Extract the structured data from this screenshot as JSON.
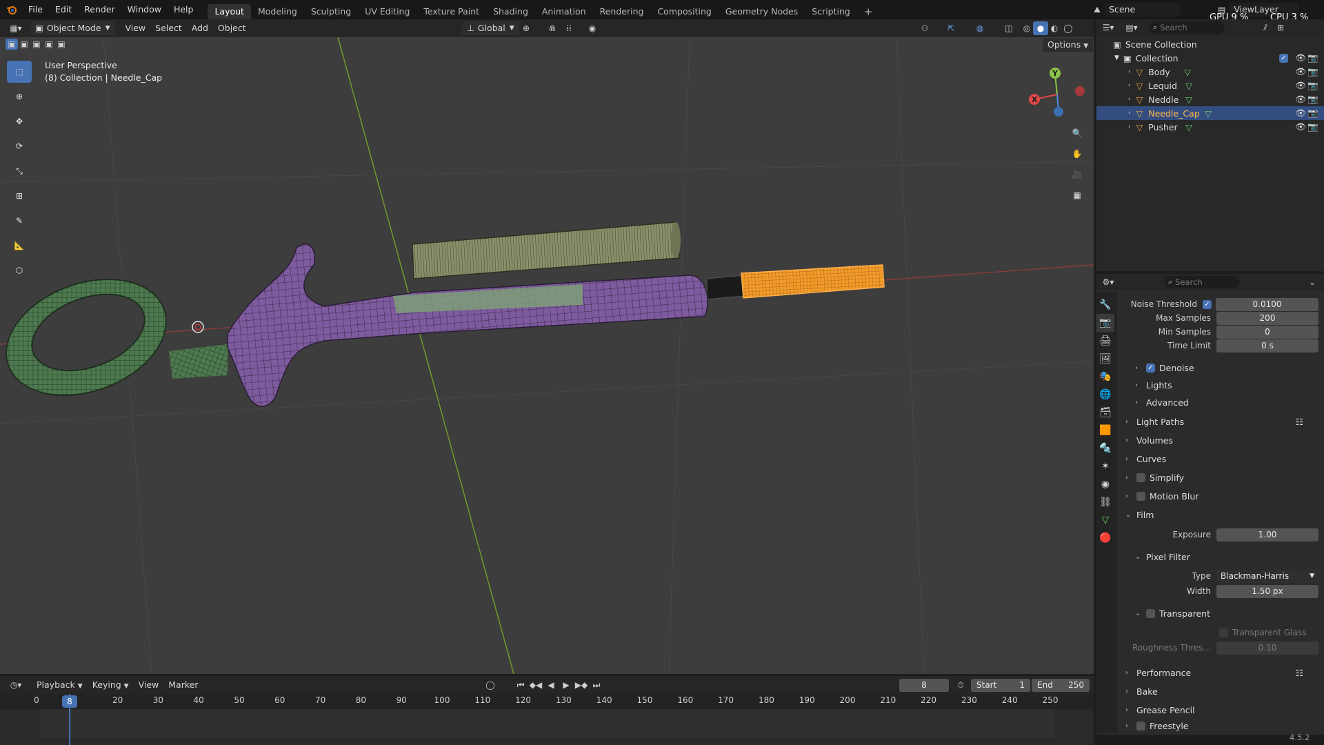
{
  "topbar": {
    "menu": [
      "File",
      "Edit",
      "Render",
      "Window",
      "Help"
    ],
    "workspaces": [
      "Layout",
      "Modeling",
      "Sculpting",
      "UV Editing",
      "Texture Paint",
      "Shading",
      "Animation",
      "Rendering",
      "Compositing",
      "Geometry Nodes",
      "Scripting"
    ],
    "active_workspace": "Layout",
    "add_tab": "+",
    "scene": "Scene",
    "view_layer": "ViewLayer",
    "gpu": "GPU  9 %",
    "cpu": "CPU  3 %"
  },
  "viewport_header": {
    "mode": "Object Mode",
    "menus": [
      "View",
      "Select",
      "Add",
      "Object"
    ],
    "orientation": "Global",
    "options": "Options"
  },
  "viewport": {
    "perspective": "User Perspective",
    "collection_info": "(8) Collection | Needle_Cap",
    "gizmo_axes": {
      "x": "X",
      "y": "Y"
    }
  },
  "outliner": {
    "search_placeholder": "Search",
    "scene_collection": "Scene Collection",
    "collection": "Collection",
    "objects": [
      "Body",
      "Lequid",
      "Neddle",
      "Needle_Cap",
      "Pusher"
    ],
    "selected": "Needle_Cap"
  },
  "properties": {
    "search_placeholder": "Search",
    "noise_threshold": {
      "label": "Noise Threshold",
      "value": "0.0100"
    },
    "max_samples": {
      "label": "Max Samples",
      "value": "200"
    },
    "min_samples": {
      "label": "Min Samples",
      "value": "0"
    },
    "time_limit": {
      "label": "Time Limit",
      "value": "0 s"
    },
    "denoise": "Denoise",
    "lights": "Lights",
    "advanced": "Advanced",
    "panels_top": [
      "Light Paths",
      "Volumes",
      "Curves",
      "Simplify",
      "Motion Blur",
      "Film"
    ],
    "exposure": {
      "label": "Exposure",
      "value": "1.00"
    },
    "pixel_filter": "Pixel Filter",
    "filter_type": {
      "label": "Type",
      "value": "Blackman-Harris"
    },
    "filter_width": {
      "label": "Width",
      "value": "1.50 px"
    },
    "transparent": "Transparent",
    "transparent_glass": "Transparent Glass",
    "roughness": {
      "label": "Roughness Thres...",
      "value": "0.10"
    },
    "panels_bottom": [
      "Performance",
      "Bake",
      "Grease Pencil",
      "Freestyle"
    ]
  },
  "timeline": {
    "menus": [
      "Playback",
      "Keying",
      "View",
      "Marker"
    ],
    "current_frame": "8",
    "start_label": "Start",
    "start": "1",
    "end_label": "End",
    "end": "250",
    "ticks": [
      "0",
      "8",
      "20",
      "30",
      "40",
      "50",
      "60",
      "70",
      "80",
      "90",
      "100",
      "110",
      "120",
      "130",
      "140",
      "150",
      "160",
      "170",
      "180",
      "190",
      "200",
      "210",
      "220",
      "230",
      "240",
      "250"
    ]
  },
  "status": {
    "version": "4.5.2"
  },
  "colors": {
    "accent": "#4772b3",
    "selected_object": "#f29d2a",
    "body_mesh": "#7d5b9e",
    "ring_mesh": "#4e7a4f",
    "cap_mesh": "#848a66"
  }
}
